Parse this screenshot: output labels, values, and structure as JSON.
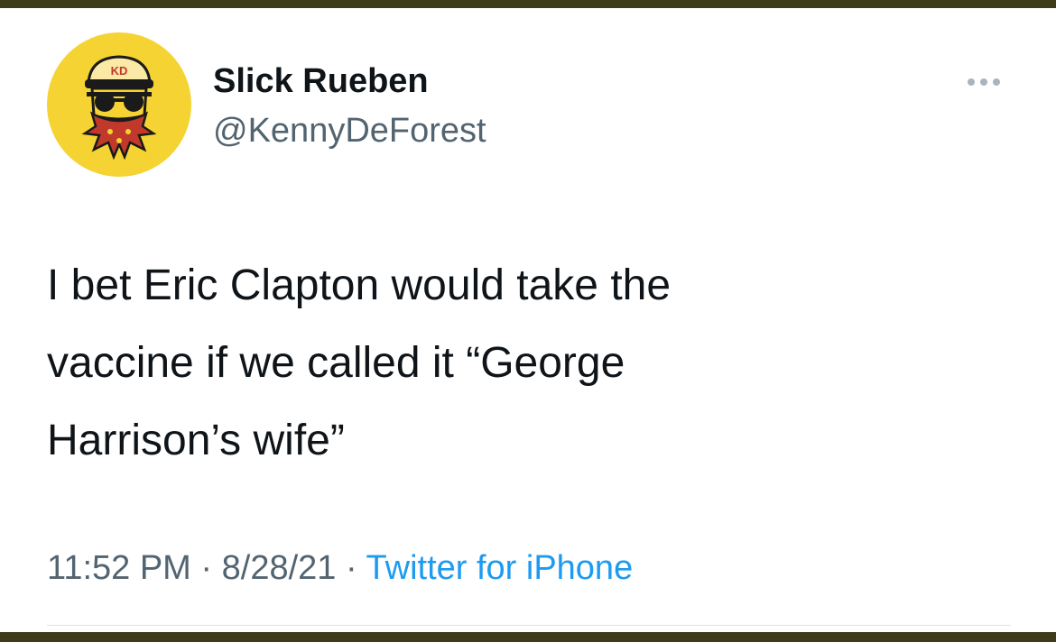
{
  "tweet": {
    "author": {
      "display_name": "Slick Rueben",
      "handle": "@KennyDeForest",
      "avatar_icon": "cartoon-face-avatar-icon",
      "avatar_badge_text": "KD",
      "avatar_color": "#f5d332"
    },
    "more_icon": "more-horizontal-icon",
    "text_lines": [
      "I bet Eric Clapton would take the",
      "vaccine if we called it “George",
      "Harrison’s wife”"
    ],
    "meta": {
      "time": "11:52 PM",
      "separator": " · ",
      "date": "8/28/21",
      "source": "Twitter for iPhone"
    }
  },
  "colors": {
    "frame": "#3f3a17",
    "text_primary": "#0f1419",
    "text_secondary": "#536471",
    "link": "#1d9bf0"
  }
}
